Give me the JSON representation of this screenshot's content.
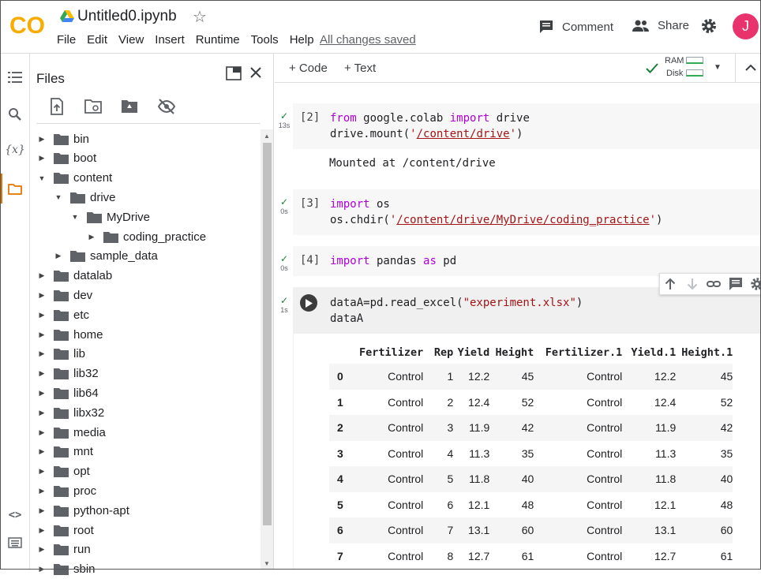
{
  "header": {
    "notebook_title": "Untitled0.ipynb",
    "logo_text": "CO",
    "menu": [
      "File",
      "Edit",
      "View",
      "Insert",
      "Runtime",
      "Tools",
      "Help"
    ],
    "saved_status": "All changes saved",
    "comment_label": "Comment",
    "share_label": "Share",
    "avatar_letter": "J",
    "colors": {
      "logo_orange": "#f9ab00",
      "avatar": "#e8336d"
    }
  },
  "files_panel": {
    "title": "Files",
    "tree": [
      {
        "label": "bin",
        "depth": 0,
        "expanded": false
      },
      {
        "label": "boot",
        "depth": 0,
        "expanded": false
      },
      {
        "label": "content",
        "depth": 0,
        "expanded": true
      },
      {
        "label": "drive",
        "depth": 1,
        "expanded": true
      },
      {
        "label": "MyDrive",
        "depth": 2,
        "expanded": true
      },
      {
        "label": "coding_practice",
        "depth": 3,
        "expanded": false
      },
      {
        "label": "sample_data",
        "depth": 1,
        "expanded": false
      },
      {
        "label": "datalab",
        "depth": 0,
        "expanded": false
      },
      {
        "label": "dev",
        "depth": 0,
        "expanded": false
      },
      {
        "label": "etc",
        "depth": 0,
        "expanded": false
      },
      {
        "label": "home",
        "depth": 0,
        "expanded": false
      },
      {
        "label": "lib",
        "depth": 0,
        "expanded": false
      },
      {
        "label": "lib32",
        "depth": 0,
        "expanded": false
      },
      {
        "label": "lib64",
        "depth": 0,
        "expanded": false
      },
      {
        "label": "libx32",
        "depth": 0,
        "expanded": false
      },
      {
        "label": "media",
        "depth": 0,
        "expanded": false
      },
      {
        "label": "mnt",
        "depth": 0,
        "expanded": false
      },
      {
        "label": "opt",
        "depth": 0,
        "expanded": false
      },
      {
        "label": "proc",
        "depth": 0,
        "expanded": false
      },
      {
        "label": "python-apt",
        "depth": 0,
        "expanded": false
      },
      {
        "label": "root",
        "depth": 0,
        "expanded": false
      },
      {
        "label": "run",
        "depth": 0,
        "expanded": false
      },
      {
        "label": "sbin",
        "depth": 0,
        "expanded": false
      }
    ]
  },
  "toolbar": {
    "add_code": "+ Code",
    "add_text": "+ Text",
    "ram_label": "RAM",
    "disk_label": "Disk"
  },
  "cells": [
    {
      "prompt": "[2]",
      "time": "13s",
      "lines": [
        [
          [
            "kw",
            "from"
          ],
          [
            "",
            " google.colab "
          ],
          [
            "kw",
            "import"
          ],
          [
            "",
            " drive"
          ]
        ],
        [
          [
            "",
            "drive.mount("
          ],
          [
            "str",
            "'"
          ],
          [
            "strp",
            "/content/drive"
          ],
          [
            "str",
            "'"
          ],
          [
            "",
            ")"
          ]
        ]
      ],
      "output": "Mounted at /content/drive"
    },
    {
      "prompt": "[3]",
      "time": "0s",
      "lines": [
        [
          [
            "kw",
            "import"
          ],
          [
            "",
            " os"
          ]
        ],
        [
          [
            "",
            "os.chdir("
          ],
          [
            "str",
            "'"
          ],
          [
            "strp",
            "/content/drive/MyDrive/coding_practice"
          ],
          [
            "str",
            "'"
          ],
          [
            "",
            ")"
          ]
        ]
      ],
      "output": ""
    },
    {
      "prompt": "[4]",
      "time": "0s",
      "lines": [
        [
          [
            "kw",
            "import"
          ],
          [
            "",
            " pandas "
          ],
          [
            "kw",
            "as"
          ],
          [
            "",
            " pd"
          ]
        ]
      ],
      "output": ""
    },
    {
      "prompt": "",
      "time": "1s",
      "lines": [
        [
          [
            "",
            "dataA=pd.read_excel("
          ],
          [
            "str",
            "\"experiment.xlsx\""
          ],
          [
            "",
            ")"
          ]
        ],
        [
          [
            "",
            "dataA"
          ]
        ]
      ],
      "output": ""
    }
  ],
  "dataframe": {
    "columns": [
      "",
      "Fertilizer",
      "Rep",
      "Yield",
      "Height",
      "Fertilizer.1",
      "Yield.1",
      "Height.1"
    ],
    "rows": [
      [
        "0",
        "Control",
        "1",
        "12.2",
        "45",
        "Control",
        "12.2",
        "45"
      ],
      [
        "1",
        "Control",
        "2",
        "12.4",
        "52",
        "Control",
        "12.4",
        "52"
      ],
      [
        "2",
        "Control",
        "3",
        "11.9",
        "42",
        "Control",
        "11.9",
        "42"
      ],
      [
        "3",
        "Control",
        "4",
        "11.3",
        "35",
        "Control",
        "11.3",
        "35"
      ],
      [
        "4",
        "Control",
        "5",
        "11.8",
        "40",
        "Control",
        "11.8",
        "40"
      ],
      [
        "5",
        "Control",
        "6",
        "12.1",
        "48",
        "Control",
        "12.1",
        "48"
      ],
      [
        "6",
        "Control",
        "7",
        "13.1",
        "60",
        "Control",
        "13.1",
        "60"
      ],
      [
        "7",
        "Control",
        "8",
        "12.7",
        "61",
        "Control",
        "12.7",
        "61"
      ]
    ]
  }
}
